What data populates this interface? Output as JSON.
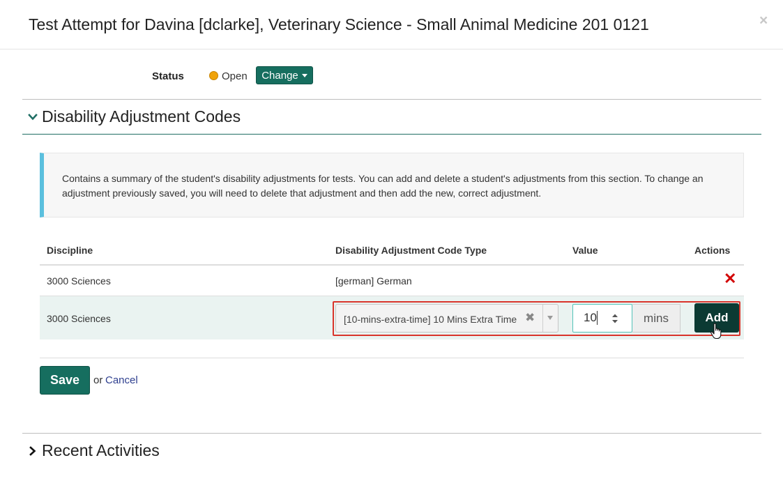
{
  "modal": {
    "title": "Test Attempt for Davina [dclarke], Veterinary Science - Small Animal Medicine 201 0121",
    "close_glyph": "×"
  },
  "status": {
    "label": "Status",
    "value": "Open",
    "dot_color": "#f0a30a",
    "change_label": "Change"
  },
  "sections": {
    "disability": {
      "title": "Disability Adjustment Codes",
      "expanded": true,
      "info_text": "Contains a summary of the student's disability adjustments for tests. You can add and delete a student's adjustments from this section. To change an adjustment previously saved, you will need to delete that adjustment and then add the new, correct adjustment."
    },
    "recent": {
      "title": "Recent Activities",
      "expanded": false
    }
  },
  "table": {
    "headers": {
      "discipline": "Discipline",
      "code_type": "Disability Adjustment Code Type",
      "value": "Value",
      "actions": "Actions"
    },
    "rows": [
      {
        "discipline": "3000 Sciences",
        "code_type": "[german] German",
        "value": "",
        "delete_glyph": "✕"
      }
    ],
    "new_row": {
      "discipline": "3000 Sciences",
      "code_type_selected": "[10-mins-extra-time] 10 Mins Extra Time",
      "clear_glyph": "✖",
      "value": "10",
      "unit": "mins",
      "add_label": "Add"
    }
  },
  "footer": {
    "save_label": "Save",
    "or_text": "or",
    "cancel_label": "Cancel"
  },
  "colors": {
    "primary": "#166e5f",
    "primary_dark": "#0b3a33",
    "info_accent": "#5bc0de",
    "highlight": "#d9342b",
    "danger": "#d20000",
    "link": "#2e3f8f"
  }
}
